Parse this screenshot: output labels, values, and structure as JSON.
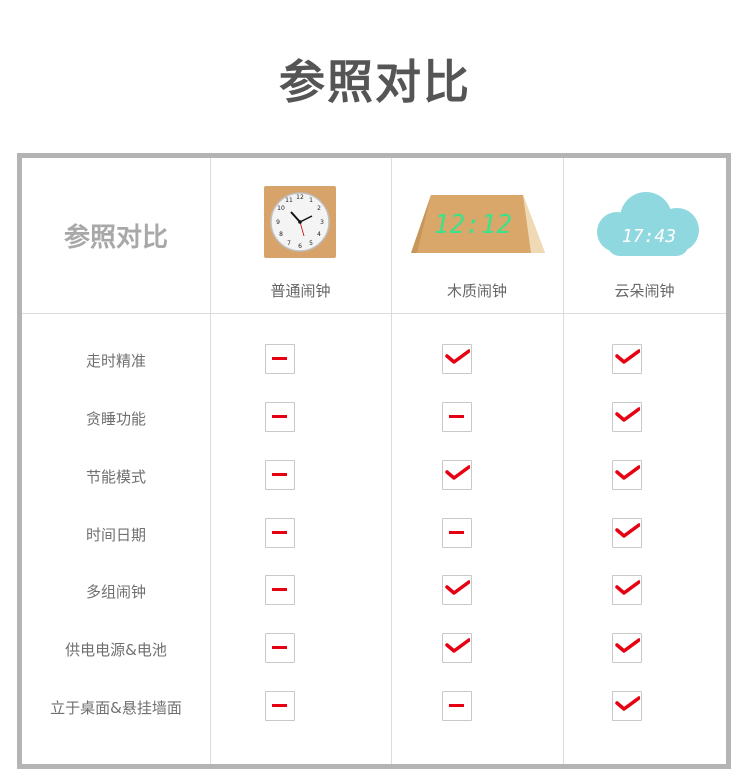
{
  "title": "参照对比",
  "table": {
    "corner_label": "参照对比",
    "products": [
      {
        "name": "普通闹钟",
        "image": "alarm-clock-image"
      },
      {
        "name": "木质闹钟",
        "image": "wooden-clock-image",
        "display": "12:12"
      },
      {
        "name": "云朵闹钟",
        "image": "cloud-clock-image",
        "display": "17:43"
      }
    ],
    "rows": [
      {
        "feature": "走时精准",
        "values": [
          "dash",
          "check",
          "check"
        ]
      },
      {
        "feature": "贪睡功能",
        "values": [
          "dash",
          "dash",
          "check"
        ]
      },
      {
        "feature": "节能模式",
        "values": [
          "dash",
          "check",
          "check"
        ]
      },
      {
        "feature": "时间日期",
        "values": [
          "dash",
          "dash",
          "check"
        ]
      },
      {
        "feature": "多组闹钟",
        "values": [
          "dash",
          "check",
          "check"
        ]
      },
      {
        "feature": "供电电源&电池",
        "values": [
          "dash",
          "check",
          "check"
        ]
      },
      {
        "feature": "立于桌面&悬挂墙面",
        "values": [
          "dash",
          "dash",
          "check"
        ]
      }
    ]
  },
  "colors": {
    "mark": "#e60012",
    "frame": "#b4b4b4",
    "cloud": "#8fd8df",
    "wood": "#d9a76a"
  }
}
